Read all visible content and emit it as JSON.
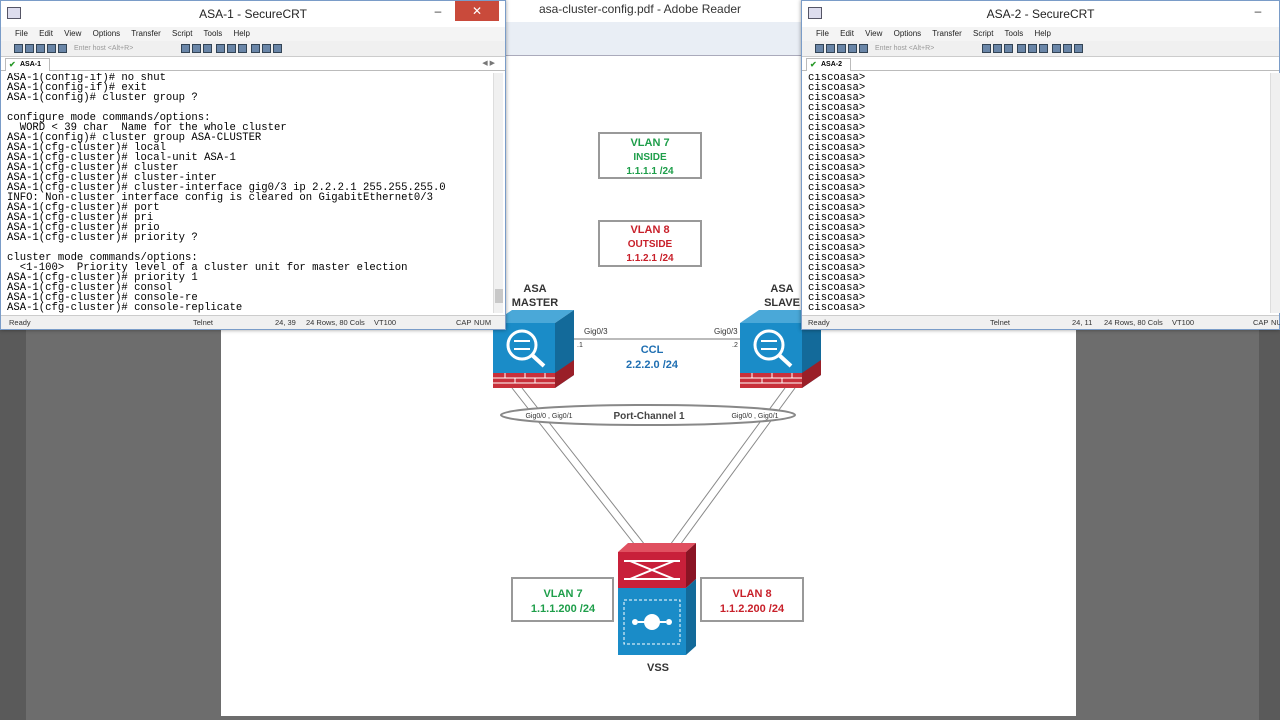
{
  "reader": {
    "title": "asa-cluster-config.pdf - Adobe Reader"
  },
  "diagram": {
    "vlan7_top": {
      "name": "VLAN 7",
      "sub": "INSIDE",
      "ip": "1.1.1.1 /24"
    },
    "vlan8_top": {
      "name": "VLAN 8",
      "sub": "OUTSIDE",
      "ip": "1.1.2.1 /24"
    },
    "asa_master": {
      "line1": "ASA",
      "line2": "MASTER"
    },
    "asa_slave": {
      "line1": "ASA",
      "line2": "SLAVE"
    },
    "ccl": {
      "name": "CCL",
      "net": "2.2.2.0 /24",
      "left_if": "Gig0/3",
      "right_if": "Gig0/3",
      "left_host": ".1",
      "right_host": ".2"
    },
    "port_channel": {
      "label": "Port-Channel 1",
      "left_ifs": "Gig0/0 , Gig0/1",
      "right_ifs": "Gig0/0 , Gig0/1"
    },
    "vlan7_bottom": {
      "name": "VLAN 7",
      "ip": "1.1.1.200 /24"
    },
    "vlan8_bottom": {
      "name": "VLAN 8",
      "ip": "1.1.2.200 /24"
    },
    "vss_label": "VSS",
    "colors": {
      "green": "#1e9e4a",
      "red": "#c8202a",
      "blue": "#1f6fb2",
      "asa_blue": "#1a8cc8",
      "vss_red": "#c8203a"
    }
  },
  "asa1": {
    "title": "ASA-1 - SecureCRT",
    "menu": [
      "File",
      "Edit",
      "View",
      "Options",
      "Transfer",
      "Script",
      "Tools",
      "Help"
    ],
    "host_placeholder": "Enter host <Alt+R>",
    "tab": "ASA-1",
    "terminal": "ASA-1(config-if)# no shut\nASA-1(config-if)# exit\nASA-1(config)# cluster group ?\n\nconfigure mode commands/options:\n  WORD < 39 char  Name for the whole cluster\nASA-1(config)# cluster group ASA-CLUSTER\nASA-1(cfg-cluster)# local\nASA-1(cfg-cluster)# local-unit ASA-1\nASA-1(cfg-cluster)# cluster\nASA-1(cfg-cluster)# cluster-inter\nASA-1(cfg-cluster)# cluster-interface gig0/3 ip 2.2.2.1 255.255.255.0\nINFO: Non-cluster interface config is cleared on GigabitEthernet0/3\nASA-1(cfg-cluster)# port\nASA-1(cfg-cluster)# pri\nASA-1(cfg-cluster)# prio\nASA-1(cfg-cluster)# priority ?\n\ncluster mode commands/options:\n  <1-100>  Priority level of a cluster unit for master election\nASA-1(cfg-cluster)# priority 1\nASA-1(cfg-cluster)# consol\nASA-1(cfg-cluster)# console-re\nASA-1(cfg-cluster)# console-replicate",
    "status": {
      "ready": "Ready",
      "proto": "Telnet",
      "pos": "24, 39",
      "size": "24 Rows, 80 Cols",
      "term": "VT100",
      "caps": "CAP",
      "num": "NUM"
    }
  },
  "asa2": {
    "title": "ASA-2 - SecureCRT",
    "menu": [
      "File",
      "Edit",
      "View",
      "Options",
      "Transfer",
      "Script",
      "Tools",
      "Help"
    ],
    "host_placeholder": "Enter host <Alt+R>",
    "tab": "ASA-2",
    "terminal": "ciscoasa>\nciscoasa>\nciscoasa>\nciscoasa>\nciscoasa>\nciscoasa>\nciscoasa>\nciscoasa>\nciscoasa>\nciscoasa>\nciscoasa>\nciscoasa>\nciscoasa>\nciscoasa>\nciscoasa>\nciscoasa>\nciscoasa>\nciscoasa>\nciscoasa>\nciscoasa>\nciscoasa>\nciscoasa>\nciscoasa>\nciscoasa>",
    "status": {
      "ready": "Ready",
      "proto": "Telnet",
      "pos": "24, 11",
      "size": "24 Rows, 80 Cols",
      "term": "VT100",
      "caps": "CAP",
      "num": "NUM"
    }
  }
}
